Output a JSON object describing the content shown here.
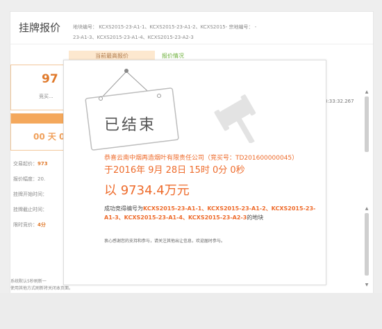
{
  "header": {
    "title": "挂牌报价",
    "meta_line1": "地块编号： KCXS2015-23-A1-1、KCXS2015-23-A1-2、KCXS2015- 宗地编号： -",
    "meta_line2": "23-A1-3、KCXS2015-23-A1-4、KCXS2015-23-A2-3"
  },
  "left_panel": {
    "top_price_label": "当前最高报价",
    "price_partial": "97",
    "price_note": "竞买...",
    "countdown_partial": "00 天 0",
    "fields": [
      {
        "label": "交易起价：",
        "value": "973"
      },
      {
        "label": "报价幅度：",
        "value": "20."
      },
      {
        "label": "挂牌开始时间：",
        "value": ""
      },
      {
        "label": "挂牌截止时间：",
        "value": ""
      },
      {
        "label": "限时竞价：",
        "value": "4分"
      }
    ],
    "footer_line1": "系统默认5秒刷新一",
    "footer_line2": "使用其他方式刷新将关闭本页面。"
  },
  "status_tab": "报价情况",
  "right_timestamp": "3:33:32.267",
  "modal": {
    "stamp_text": "已结束",
    "winner": "恭喜云南中烟再造烟叶有限责任公司（竞买号：TD201600000045）",
    "time": "于2016年 9月 28日 15时 0分 0秒",
    "price": "以 9734.4万元",
    "detail_prefix": "成功竞得编号为",
    "detail_codes": "KCXS2015-23-A1-1、KCXS2015-23-A1-2、KCXS2015-23-A1-3、KCXS2015-23-A1-4、KCXS2015-23-A2-3",
    "detail_suffix": "的地块",
    "thanks": "衷心感谢您的支持和参与，请关注其他出让信息，欢迎届时参与。"
  },
  "colors": {
    "accent": "#ee6b2b",
    "tab_green": "#6fb13e",
    "orange_bar": "#f4a85c"
  }
}
